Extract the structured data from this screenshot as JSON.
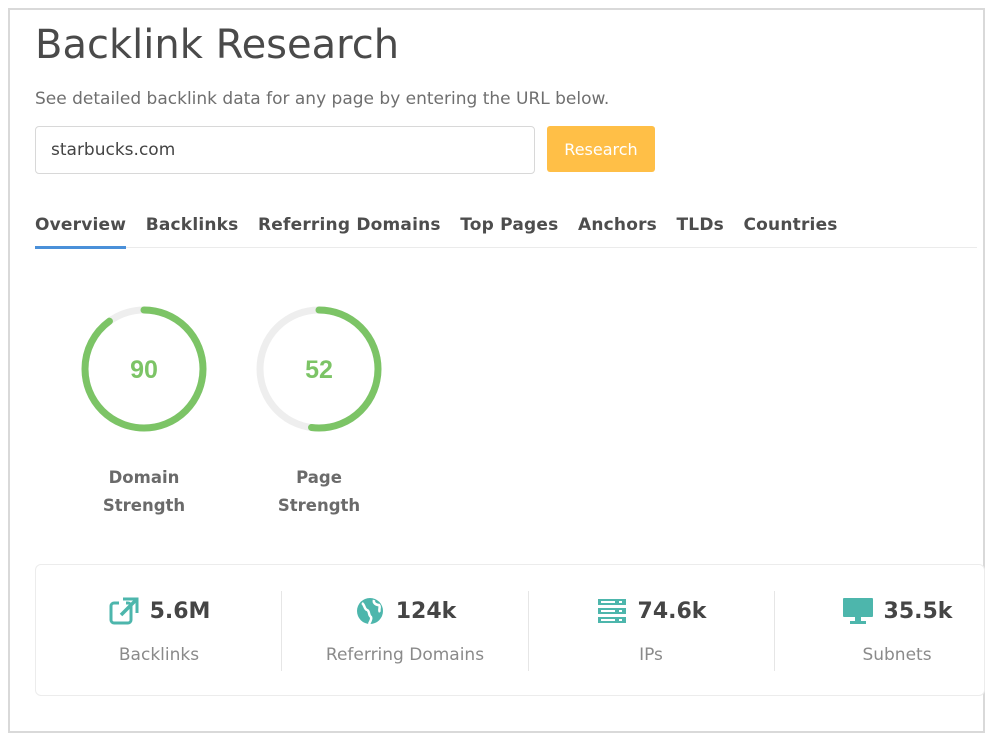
{
  "page": {
    "title": "Backlink Research",
    "subtitle": "See detailed backlink data for any page by entering the URL below."
  },
  "search": {
    "value": "starbucks.com",
    "button_label": "Research"
  },
  "tabs": [
    {
      "label": "Overview",
      "active": true
    },
    {
      "label": "Backlinks",
      "active": false
    },
    {
      "label": "Referring Domains",
      "active": false
    },
    {
      "label": "Top Pages",
      "active": false
    },
    {
      "label": "Anchors",
      "active": false
    },
    {
      "label": "TLDs",
      "active": false
    },
    {
      "label": "Countries",
      "active": false
    }
  ],
  "gauges": [
    {
      "value": 90,
      "label_line1": "Domain",
      "label_line2": "Strength"
    },
    {
      "value": 52,
      "label_line1": "Page",
      "label_line2": "Strength"
    }
  ],
  "stats": [
    {
      "icon": "external-link-icon",
      "value": "5.6M",
      "label": "Backlinks"
    },
    {
      "icon": "globe-icon",
      "value": "124k",
      "label": "Referring Domains"
    },
    {
      "icon": "server-icon",
      "value": "74.6k",
      "label": "IPs"
    },
    {
      "icon": "monitor-icon",
      "value": "35.5k",
      "label": "Subnets"
    }
  ],
  "colors": {
    "accent_orange": "#ffbf47",
    "gauge_green": "#7cc466",
    "gauge_track": "#eeeeee",
    "tab_underline": "#4a90d9",
    "icon_teal": "#4db6ac"
  }
}
